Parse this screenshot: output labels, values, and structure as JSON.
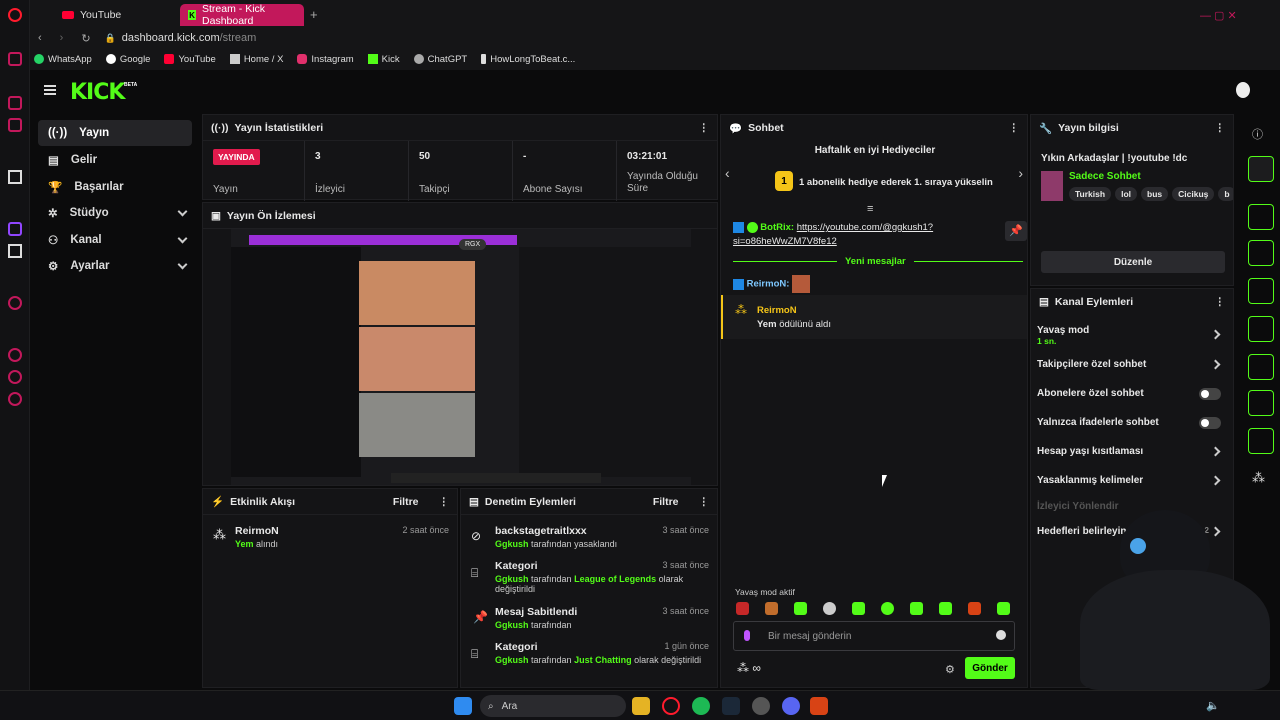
{
  "browser": {
    "tabs": [
      {
        "label": "YouTube"
      },
      {
        "label": "Stream - Kick Dashboard"
      }
    ],
    "url_domain": "dashboard.kick.com",
    "url_path": "/stream",
    "new_tab": "+"
  },
  "bookmarks": [
    "WhatsApp",
    "Google",
    "YouTube",
    "Home / X",
    "Instagram",
    "Kick",
    "ChatGPT",
    "HowLongToBeat.c..."
  ],
  "brand": {
    "logo": "KICK",
    "beta": "BETA"
  },
  "nav": {
    "items": [
      "Yayın",
      "Gelir",
      "Başarılar",
      "Stüdyo",
      "Kanal",
      "Ayarlar"
    ]
  },
  "stats": {
    "title": "Yayın İstatistikleri",
    "live_badge": "YAYINDA",
    "live_label": "Yayın",
    "items": [
      {
        "value": "3",
        "label": "İzleyici"
      },
      {
        "value": "50",
        "label": "Takipçi"
      },
      {
        "value": "-",
        "label": "Abone Sayısı"
      },
      {
        "value": "03:21:01",
        "label": "Yayında Olduğu Süre"
      }
    ]
  },
  "preview": {
    "title": "Yayın Ön İzlemesi",
    "badge": "RGX"
  },
  "activity": {
    "title": "Etkinlik Akışı",
    "filter": "Filtre",
    "items": [
      {
        "user": "ReirmoN",
        "reward": "Yem",
        "action": "alındı",
        "time": "2 saat önce"
      }
    ]
  },
  "moderation": {
    "title": "Denetim Eylemleri",
    "filter": "Filtre",
    "items": [
      {
        "title": "backstagetraitlxxx",
        "actor": "Ggkush",
        "text": "tarafından yasaklandı",
        "extra": "",
        "extra2": "",
        "time": "3 saat önce"
      },
      {
        "title": "Kategori",
        "actor": "Ggkush",
        "text": "tarafından",
        "extra": "League of Legends",
        "extra2": "olarak değiştirildi",
        "time": "3 saat önce"
      },
      {
        "title": "Mesaj Sabitlendi",
        "actor": "Ggkush",
        "text": "tarafından",
        "extra": "",
        "extra2": "",
        "time": "3 saat önce"
      },
      {
        "title": "Kategori",
        "actor": "Ggkush",
        "text": "tarafından",
        "extra": "Just Chatting",
        "extra2": "olarak değiştirildi",
        "time": "1 gün önce"
      }
    ]
  },
  "chat": {
    "title": "Sohbet",
    "gifters_title": "Haftalık en iyi Hediyeciler",
    "rank": "1",
    "gift_text": "1 abonelik hediye ederek 1. sıraya yükselin",
    "pinned_user": "BotRix:",
    "pinned_link": "https://youtube.com/@ggkush1?si=o86heWwZM7V8fe12",
    "new_messages": "Yeni mesajlar",
    "msg_user": "ReirmoN:",
    "reward_user": "ReirmoN",
    "reward_text": "Yem",
    "reward_suffix": "ödülünü aldı",
    "slow_mode": "Yavaş mod aktif",
    "placeholder": "Bir mesaj gönderin",
    "send": "Gönder"
  },
  "stream_info": {
    "title": "Yayın bilgisi",
    "stream_title": "Yıkın Arkadaşlar | !youtube !dc",
    "category": "Sadece Sohbet",
    "tags": [
      "Turkish",
      "lol",
      "bus",
      "Cicikuş",
      "b"
    ],
    "edit": "Düzenle"
  },
  "channel_actions": {
    "title": "Kanal Eylemleri",
    "items": [
      {
        "label": "Yavaş mod",
        "sub": "1 sn.",
        "kind": "arrow"
      },
      {
        "label": "Takipçilere özel sohbet",
        "sub": "",
        "kind": "arrow"
      },
      {
        "label": "Abonelere özel sohbet",
        "sub": "",
        "kind": "toggle"
      },
      {
        "label": "Yalnızca ifadelerle sohbet",
        "sub": "",
        "kind": "toggle"
      },
      {
        "label": "Hesap yaşı kısıtlaması",
        "sub": "",
        "kind": "arrow"
      },
      {
        "label": "Yasaklanmış kelimeler",
        "sub": "",
        "kind": "arrow"
      }
    ],
    "disabled": "İzleyici Yönlendir",
    "goals": "Hedefleri belirleyin",
    "goals_suffix": "r - 2"
  },
  "taskbar": {
    "search": "Ara"
  }
}
